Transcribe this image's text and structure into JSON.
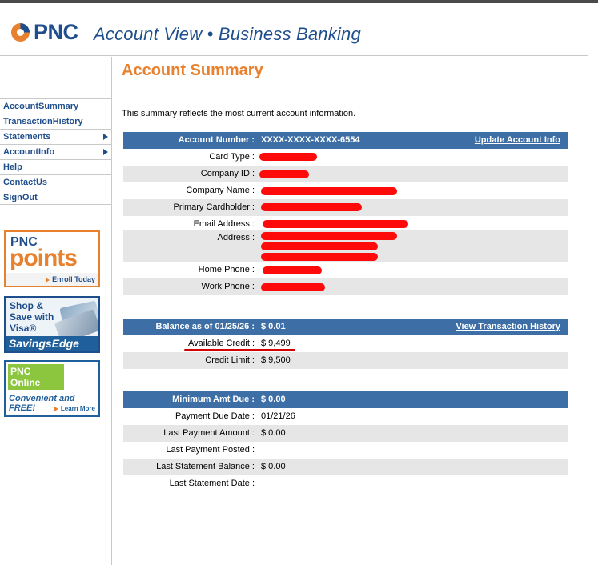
{
  "brand": {
    "logo_text": "PNC",
    "app_title": "Account View • Business Banking"
  },
  "colors": {
    "brand_blue": "#1f4e8c",
    "brand_orange": "#e8812e",
    "table_header": "#3d6ea5",
    "redaction": "#ff0a0a"
  },
  "nav": {
    "items": [
      {
        "label": "AccountSummary",
        "has_arrow": false
      },
      {
        "label": "TransactionHistory",
        "has_arrow": false
      },
      {
        "label": "Statements",
        "has_arrow": true
      },
      {
        "label": "AccountInfo",
        "has_arrow": true
      },
      {
        "label": "Help",
        "has_arrow": false
      },
      {
        "label": "ContactUs",
        "has_arrow": false
      },
      {
        "label": "SignOut",
        "has_arrow": false
      }
    ]
  },
  "promos": {
    "points": {
      "line1": "PNC",
      "line2": "points",
      "cta": "Enroll Today"
    },
    "shop": {
      "line1": "Shop & Save with Visa®",
      "line2": "SavingsEdge"
    },
    "online": {
      "line1": "PNC Online Banking",
      "line2": "Convenient and FREE!",
      "cta": "Learn More"
    }
  },
  "main": {
    "title": "Account Summary",
    "intro": "This summary reflects the most current account information."
  },
  "account_section": {
    "header_label": "Account Number :",
    "header_value": "XXXX-XXXX-XXXX-6554",
    "header_link": "Update Account Info",
    "rows": [
      {
        "label": "Card Type :"
      },
      {
        "label": "Company ID :"
      },
      {
        "label": "Company Name :"
      },
      {
        "label": "Primary Cardholder :"
      },
      {
        "label": "Email Address :"
      },
      {
        "label": "Address :"
      },
      {
        "label": "Home Phone :"
      },
      {
        "label": "Work Phone :"
      }
    ]
  },
  "balance_section": {
    "header_label": "Balance as of 01/25/26 :",
    "header_value": "$ 0.01",
    "header_link": "View Transaction History",
    "rows": [
      {
        "label": "Available Credit :",
        "value": "$ 9,499"
      },
      {
        "label": "Credit Limit :",
        "value": "$ 9,500"
      }
    ]
  },
  "payment_section": {
    "header_label": "Minimum Amt Due :",
    "header_value": "$ 0.00",
    "rows": [
      {
        "label": "Payment Due Date :",
        "value": "01/21/26"
      },
      {
        "label": "Last Payment Amount :",
        "value": "$ 0.00"
      },
      {
        "label": "Last Payment Posted :",
        "value": ""
      },
      {
        "label": "Last Statement Balance :",
        "value": "$ 0.00"
      },
      {
        "label": "Last Statement Date :",
        "value": ""
      }
    ]
  }
}
